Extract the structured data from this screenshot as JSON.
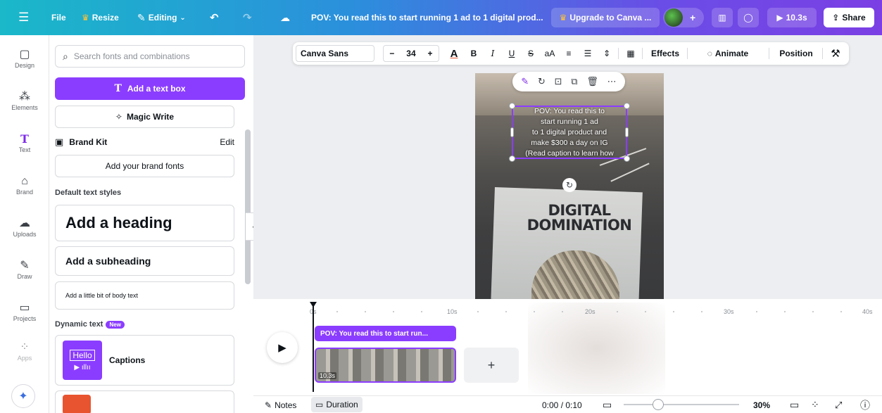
{
  "topbar": {
    "menu_icon": "hamburger-icon",
    "file_label": "File",
    "resize_label": "Resize",
    "editing_label": "Editing",
    "doc_title": "POV: You read this to start running 1 ad to 1 digital prod...",
    "upgrade_label": "Upgrade to Canva ...",
    "play_time": "10.3s",
    "share_label": "Share",
    "gradient_start": "#1ab8c9",
    "gradient_end": "#7b3fe4"
  },
  "rail": {
    "items": [
      {
        "label": "Design",
        "icon": "layout-icon"
      },
      {
        "label": "Elements",
        "icon": "elements-icon"
      },
      {
        "label": "Text",
        "icon": "text-icon"
      },
      {
        "label": "Brand",
        "icon": "brand-icon"
      },
      {
        "label": "Uploads",
        "icon": "upload-icon"
      },
      {
        "label": "Draw",
        "icon": "pen-icon"
      },
      {
        "label": "Projects",
        "icon": "folder-icon"
      },
      {
        "label": "Apps",
        "icon": "apps-icon"
      }
    ]
  },
  "panel": {
    "search_placeholder": "Search fonts and combinations",
    "add_text_box": "Add a text box",
    "magic_write": "Magic Write",
    "brand_kit": "Brand Kit",
    "brand_edit": "Edit",
    "add_brand_fonts": "Add your brand fonts",
    "default_styles": "Default text styles",
    "heading": "Add a heading",
    "subheading": "Add a subheading",
    "body": "Add a little bit of body text",
    "dynamic_text": "Dynamic text",
    "new_badge": "New",
    "captions": "Captions",
    "hello_thumb": "Hello"
  },
  "format": {
    "font": "Canva Sans",
    "size": "34",
    "effects": "Effects",
    "animate": "Animate",
    "position": "Position"
  },
  "design": {
    "overlay_text": "POV: You read this to\nstart running 1 ad\nto 1 digital product and\nmake $300 a day on IG\n(Read caption to learn how",
    "book_title_1": "DIGITAL",
    "book_title_2": "DOMINATION"
  },
  "timeline": {
    "ticks": [
      "0s",
      "10s",
      "20s",
      "30s",
      "40s"
    ],
    "text_track": "POV: You read this to start run...",
    "video_duration": "10.3s"
  },
  "bottombar": {
    "notes": "Notes",
    "duration": "Duration",
    "time": "0:00 / 0:10",
    "zoom": "30%",
    "zoom_fraction": 0.3
  },
  "colors": {
    "accent": "#8b3dff",
    "crown": "#ffc233"
  }
}
